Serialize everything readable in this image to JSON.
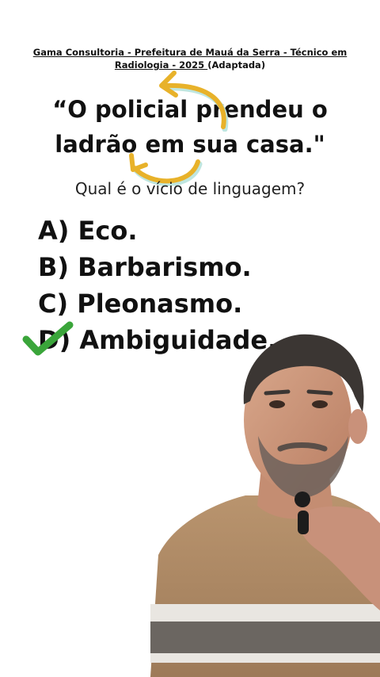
{
  "source": {
    "line1": "Gama Consultoria - Prefeitura de Mauá da Serra - Técnico em",
    "line2_link": "Radiologia - 2025 ",
    "line2_note": "(Adaptada)"
  },
  "quote": {
    "line1": "“O policial prendeu o",
    "line2": "ladrão em sua casa.\""
  },
  "question": "Qual é o vício de linguagem?",
  "options": [
    {
      "letter": "A)",
      "text": "Eco."
    },
    {
      "letter": "B)",
      "text": "Barbarismo."
    },
    {
      "letter": "C)",
      "text": "Pleonasmo."
    },
    {
      "letter": "D)",
      "text": "Ambiguidade."
    }
  ],
  "correct_option": "D",
  "colors": {
    "arrow": "#e8b22a",
    "check": "#3aa53a",
    "text": "#111111"
  },
  "icons": [
    "curved-arrow-icon",
    "check-icon"
  ]
}
